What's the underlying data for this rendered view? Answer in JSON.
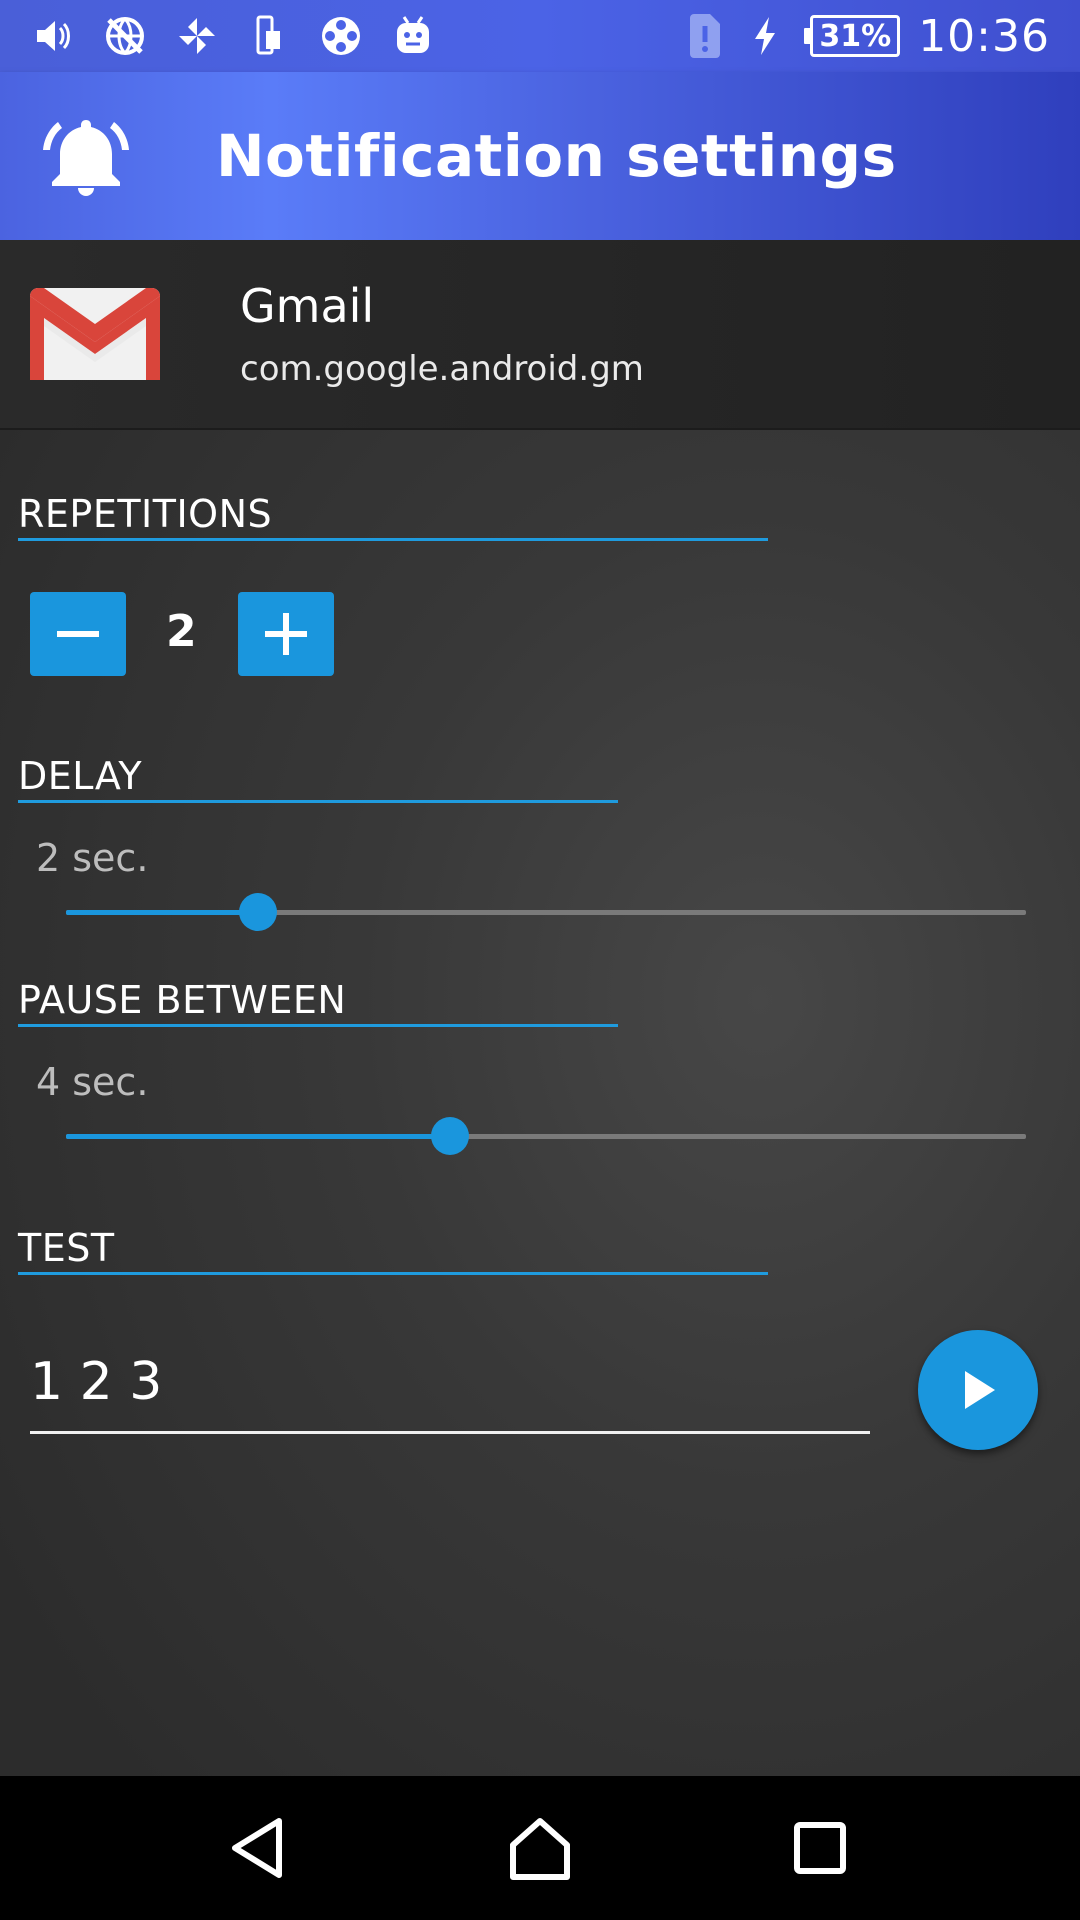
{
  "status_bar": {
    "battery_percent": "31%",
    "time": "10:36",
    "icons": [
      "volume-icon",
      "no-network-icon",
      "pinwheel-icon",
      "phone-sim-icon",
      "film-reel-icon",
      "android-icon",
      "sim-alert-icon",
      "charging-icon",
      "battery-icon"
    ]
  },
  "app_bar": {
    "title": "Notification settings",
    "icon": "bell-icon"
  },
  "app": {
    "name": "Gmail",
    "package": "com.google.android.gm",
    "icon": "gmail-icon"
  },
  "repetitions": {
    "label": "REPETITIONS",
    "value": "2"
  },
  "delay": {
    "label": "DELAY",
    "value_label": "2 sec.",
    "fraction": 0.2
  },
  "pause_between": {
    "label": "PAUSE BETWEEN",
    "value_label": "4 sec.",
    "fraction": 0.4
  },
  "test": {
    "label": "TEST",
    "input_value": "1 2 3"
  },
  "colors": {
    "accent": "#1a96dd",
    "app_bar": "#4b63e0"
  }
}
